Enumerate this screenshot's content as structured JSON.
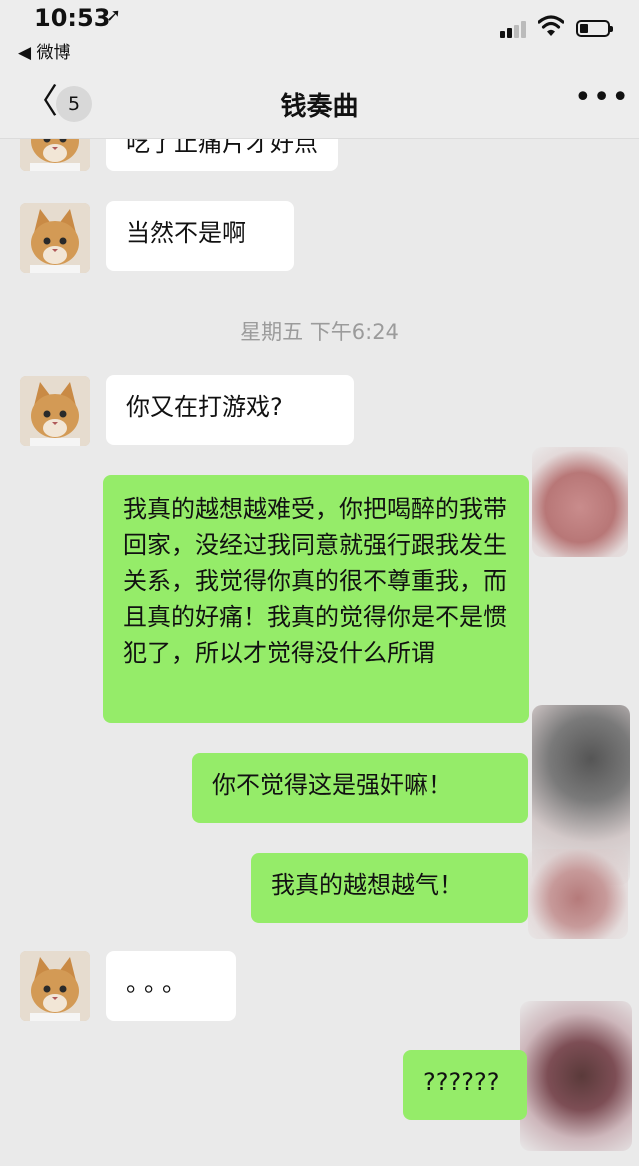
{
  "status_bar": {
    "time": "10:53",
    "location_icon": "location-arrow-icon",
    "back_to_app": "◀ 微博",
    "signal_icon": "signal-icon",
    "wifi_icon": "wifi-icon",
    "battery_icon": "battery-icon",
    "battery_level": 0.3
  },
  "nav": {
    "back_icon": "chevron-left-icon",
    "unread_count": "5",
    "title": "钱奏曲",
    "more_icon": "more-dots-icon"
  },
  "messages": [
    {
      "side": "in",
      "text": "吃了止痛片才好点"
    },
    {
      "side": "in",
      "text": "当然不是啊"
    },
    {
      "type": "timestamp",
      "text": "星期五 下午6:24"
    },
    {
      "side": "in",
      "text": "你又在打游戏?"
    },
    {
      "side": "out",
      "text": "我真的越想越难受，你把喝醉的我带回家，没经过我同意就强行跟我发生关系，我觉得你真的很不尊重我，而且真的好痛！我真的觉得你是不是惯犯了，所以才觉得没什么所谓"
    },
    {
      "side": "out",
      "text": "你不觉得这是强奸嘛！"
    },
    {
      "side": "out",
      "text": "我真的越想越气！"
    },
    {
      "side": "in",
      "text": "。。。"
    },
    {
      "side": "out",
      "text": "??????"
    }
  ],
  "colors": {
    "background": "#eaeaea",
    "incoming_bubble": "#ffffff",
    "outgoing_bubble": "#95ec69",
    "timestamp_text": "#9b9b9b"
  }
}
